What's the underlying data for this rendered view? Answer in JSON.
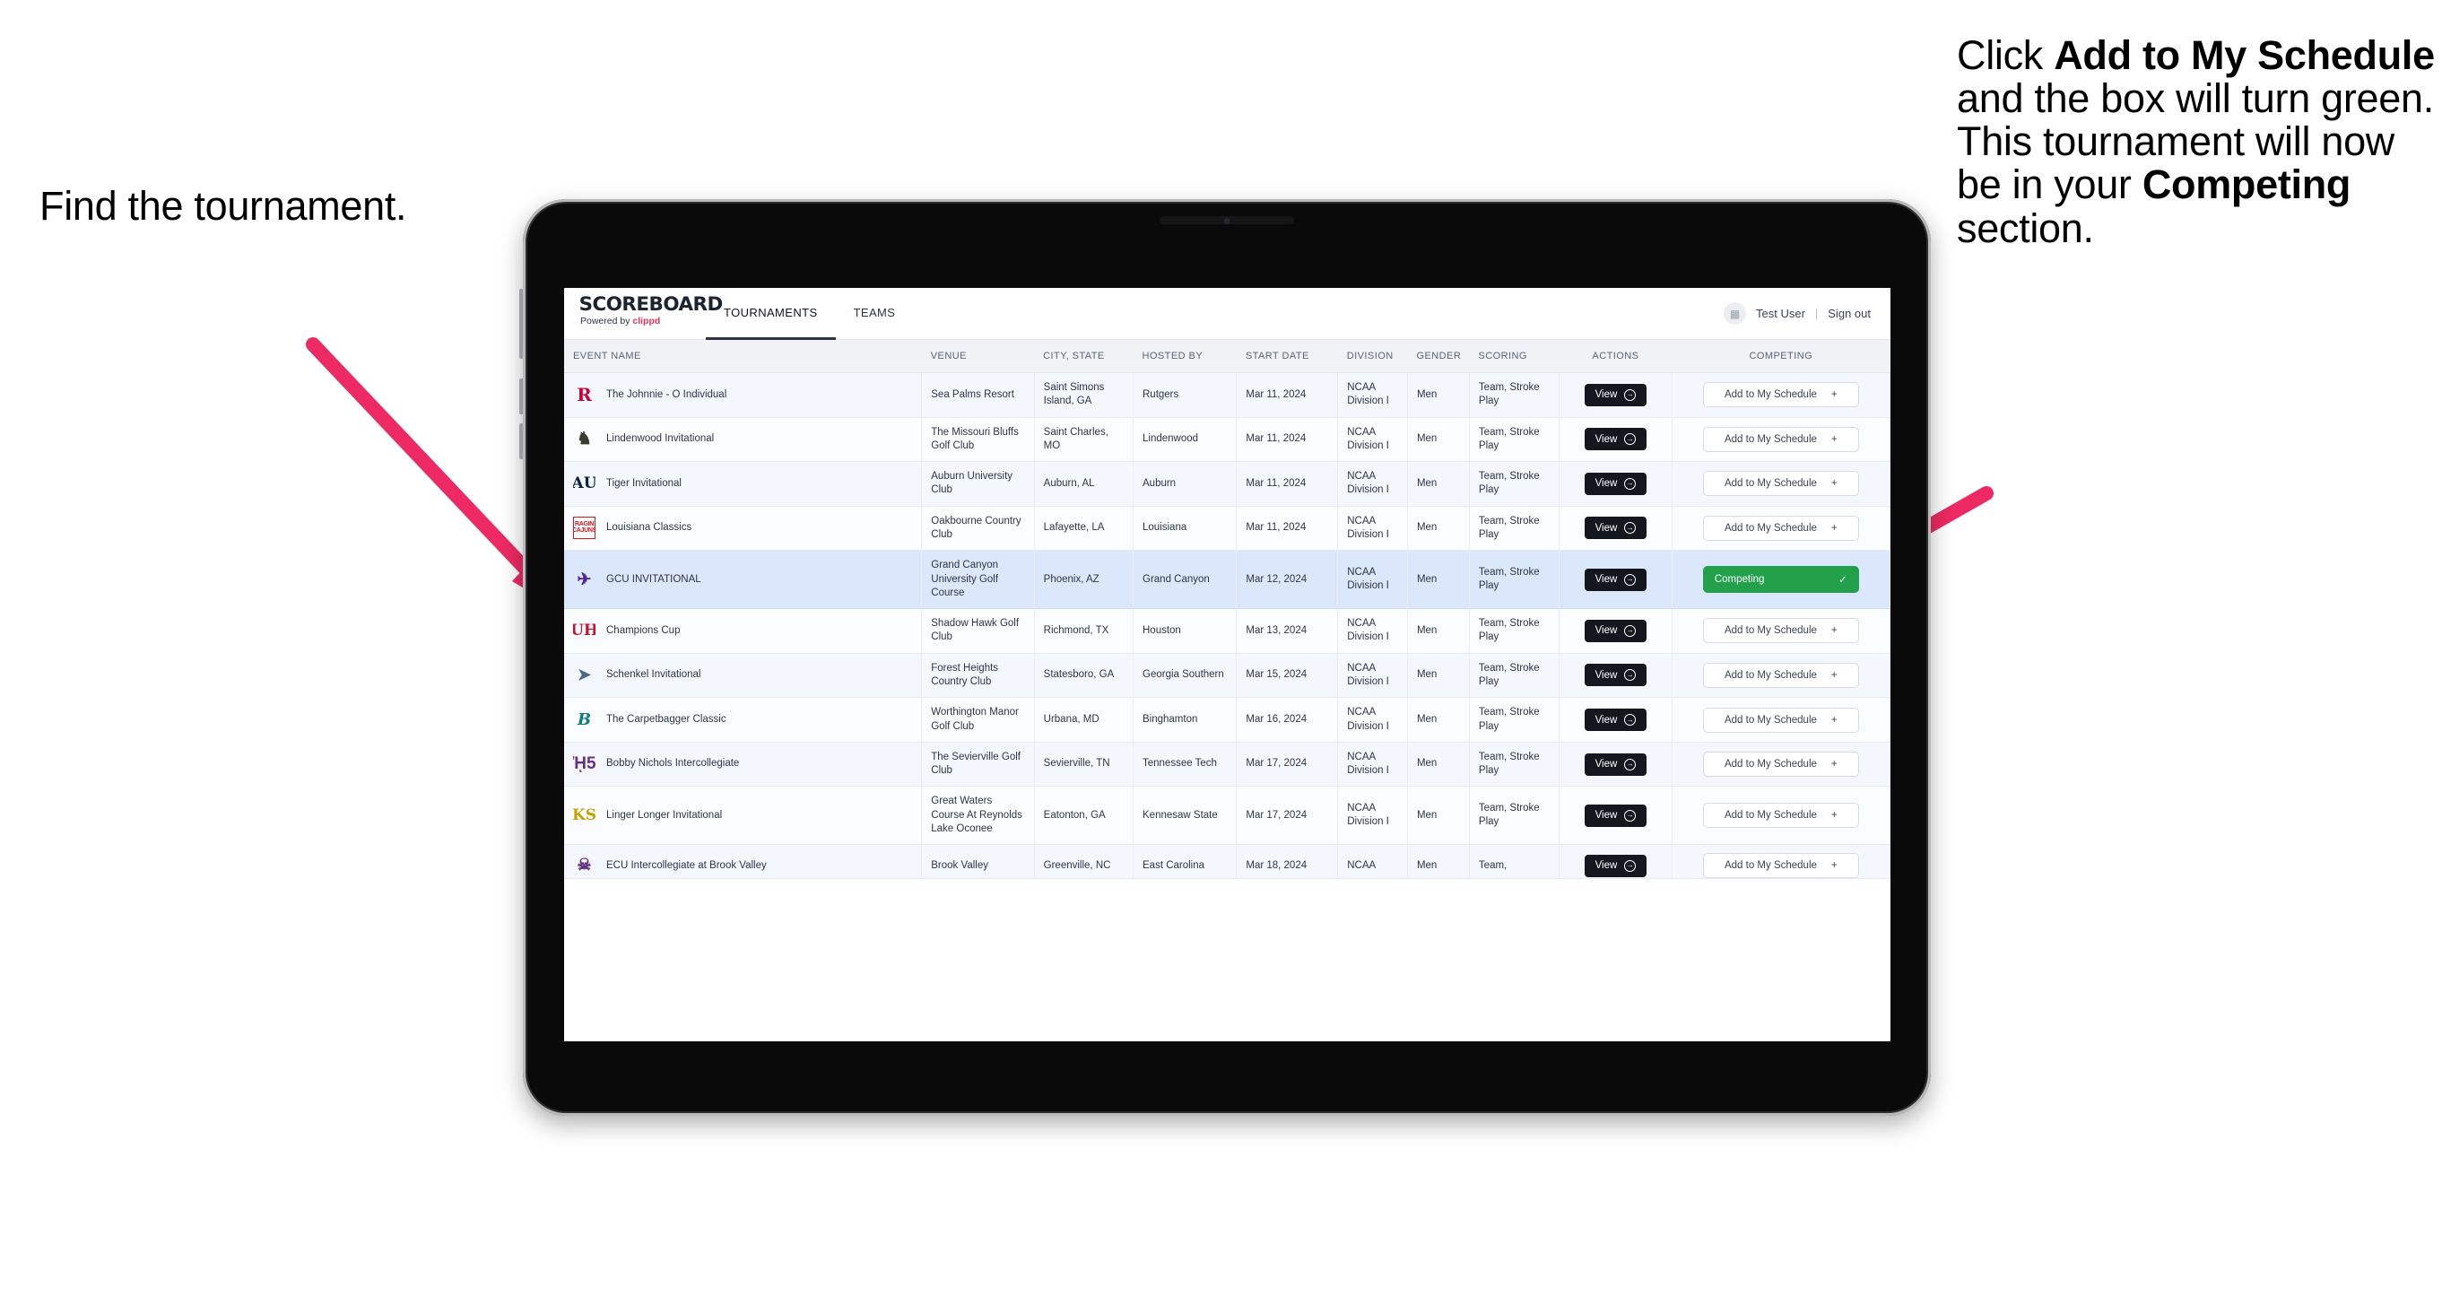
{
  "annotations": {
    "left": "Find the tournament.",
    "right_parts": [
      {
        "t": "Click ",
        "b": false
      },
      {
        "t": "Add to My Schedule",
        "b": true
      },
      {
        "t": " and the box will turn green. This tournament will now be in your ",
        "b": false
      },
      {
        "t": "Competing",
        "b": true
      },
      {
        "t": " section.",
        "b": false
      }
    ],
    "arrow_color": "#ED2A63"
  },
  "app": {
    "brand": {
      "name": "SCOREBOARD",
      "powered_prefix": "Powered by ",
      "powered_brand": "clippd"
    },
    "tabs": [
      {
        "label": "TOURNAMENTS",
        "active": true
      },
      {
        "label": "TEAMS",
        "active": false
      }
    ],
    "user": {
      "avatar_icon": "user-avatar-icon",
      "name": "Test User",
      "separator": "|",
      "signout": "Sign out"
    }
  },
  "table": {
    "columns": [
      "EVENT NAME",
      "VENUE",
      "CITY, STATE",
      "HOSTED BY",
      "START DATE",
      "DIVISION",
      "GENDER",
      "SCORING",
      "ACTIONS",
      "COMPETING"
    ],
    "view_label": "View",
    "view_icon": "arrow-right-circle-icon",
    "add_label": "Add to My Schedule",
    "add_icon": "plus-icon",
    "competing_label": "Competing",
    "competing_icon": "check-icon",
    "competing_color": "#22A04A",
    "rows": [
      {
        "logo": "rutgers-logo",
        "logo_class": "lg-rutgers",
        "logo_glyph": "R",
        "event": "The Johnnie - O Individual",
        "venue": "Sea Palms Resort",
        "city": "Saint Simons Island, GA",
        "host": "Rutgers",
        "date": "Mar 11, 2024",
        "division": "NCAA Division I",
        "gender": "Men",
        "scoring": "Team, Stroke Play",
        "competing": false
      },
      {
        "logo": "lindenwood-logo",
        "logo_class": "lg-lindenwood",
        "logo_glyph": "♞",
        "event": "Lindenwood Invitational",
        "venue": "The Missouri Bluffs Golf Club",
        "city": "Saint Charles, MO",
        "host": "Lindenwood",
        "date": "Mar 11, 2024",
        "division": "NCAA Division I",
        "gender": "Men",
        "scoring": "Team, Stroke Play",
        "competing": false
      },
      {
        "logo": "auburn-logo",
        "logo_class": "lg-auburn",
        "logo_glyph": "AU",
        "event": "Tiger Invitational",
        "venue": "Auburn University Club",
        "city": "Auburn, AL",
        "host": "Auburn",
        "date": "Mar 11, 2024",
        "division": "NCAA Division I",
        "gender": "Men",
        "scoring": "Team, Stroke Play",
        "competing": false
      },
      {
        "logo": "louisiana-ragin-cajuns-logo",
        "logo_class": "lg-louisiana",
        "logo_glyph": "RAGIN CAJUNS",
        "event": "Louisiana Classics",
        "venue": "Oakbourne Country Club",
        "city": "Lafayette, LA",
        "host": "Louisiana",
        "date": "Mar 11, 2024",
        "division": "NCAA Division I",
        "gender": "Men",
        "scoring": "Team, Stroke Play",
        "competing": false
      },
      {
        "logo": "grand-canyon-lopes-logo",
        "logo_class": "lg-gcu",
        "logo_glyph": "✈",
        "event": "GCU INVITATIONAL",
        "venue": "Grand Canyon University Golf Course",
        "city": "Phoenix, AZ",
        "host": "Grand Canyon",
        "date": "Mar 12, 2024",
        "division": "NCAA Division I",
        "gender": "Men",
        "scoring": "Team, Stroke Play",
        "competing": true,
        "selected": true
      },
      {
        "logo": "houston-cougars-logo",
        "logo_class": "lg-houston",
        "logo_glyph": "UH",
        "event": "Champions Cup",
        "venue": "Shadow Hawk Golf Club",
        "city": "Richmond, TX",
        "host": "Houston",
        "date": "Mar 13, 2024",
        "division": "NCAA Division I",
        "gender": "Men",
        "scoring": "Team, Stroke Play",
        "competing": false
      },
      {
        "logo": "georgia-southern-eagles-logo",
        "logo_class": "lg-gsouthern",
        "logo_glyph": "➤",
        "event": "Schenkel Invitational",
        "venue": "Forest Heights Country Club",
        "city": "Statesboro, GA",
        "host": "Georgia Southern",
        "date": "Mar 15, 2024",
        "division": "NCAA Division I",
        "gender": "Men",
        "scoring": "Team, Stroke Play",
        "competing": false
      },
      {
        "logo": "binghamton-bearcats-logo",
        "logo_class": "lg-binghamton",
        "logo_glyph": "B",
        "event": "The Carpetbagger Classic",
        "venue": "Worthington Manor Golf Club",
        "city": "Urbana, MD",
        "host": "Binghamton",
        "date": "Mar 16, 2024",
        "division": "NCAA Division I",
        "gender": "Men",
        "scoring": "Team, Stroke Play",
        "competing": false
      },
      {
        "logo": "tennessee-tech-golden-eagles-logo",
        "logo_class": "lg-tntech",
        "logo_glyph": "ᾘ5",
        "event": "Bobby Nichols Intercollegiate",
        "venue": "The Sevierville Golf Club",
        "city": "Sevierville, TN",
        "host": "Tennessee Tech",
        "date": "Mar 17, 2024",
        "division": "NCAA Division I",
        "gender": "Men",
        "scoring": "Team, Stroke Play",
        "competing": false
      },
      {
        "logo": "kennesaw-state-owls-logo",
        "logo_class": "lg-kennesaw",
        "logo_glyph": "KS",
        "event": "Linger Longer Invitational",
        "venue": "Great Waters Course At Reynolds Lake Oconee",
        "city": "Eatonton, GA",
        "host": "Kennesaw State",
        "date": "Mar 17, 2024",
        "division": "NCAA Division I",
        "gender": "Men",
        "scoring": "Team, Stroke Play",
        "competing": false
      },
      {
        "logo": "east-carolina-pirates-logo",
        "logo_class": "lg-ecu",
        "logo_glyph": "☠",
        "event": "ECU Intercollegiate at Brook Valley",
        "venue": "Brook Valley",
        "city": "Greenville, NC",
        "host": "East Carolina",
        "date": "Mar 18, 2024",
        "division": "NCAA",
        "gender": "Men",
        "scoring": "Team,",
        "competing": false,
        "cutoff": true
      }
    ]
  }
}
